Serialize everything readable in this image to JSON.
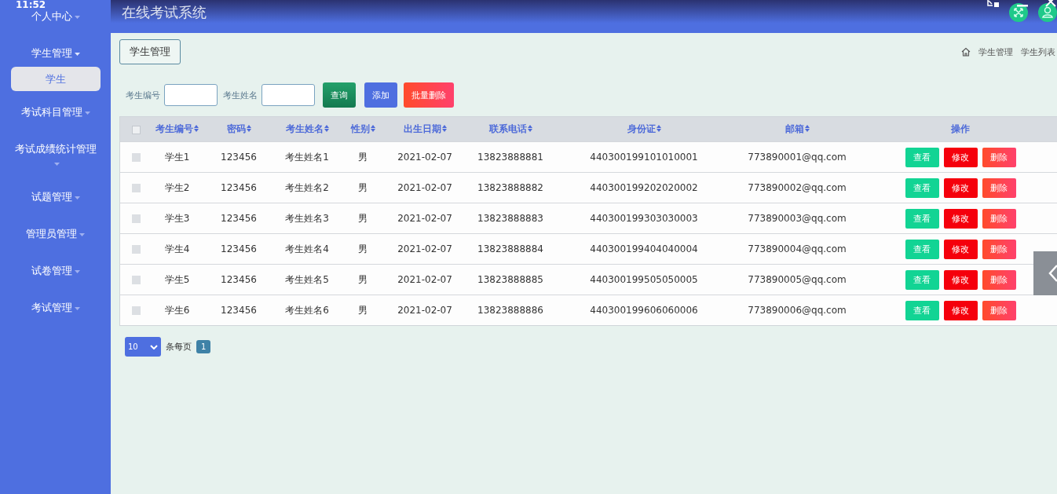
{
  "status_time": "11:52",
  "header": {
    "title": "在线考试系统"
  },
  "sidebar": {
    "items": [
      {
        "label": "个人中心",
        "expanded": false
      },
      {
        "label": "学生管理",
        "expanded": true,
        "children": [
          {
            "label": "学生",
            "selected": true
          }
        ]
      },
      {
        "label": "考试科目管理",
        "expanded": false
      },
      {
        "label": "考试成绩统计管理",
        "expanded": false
      },
      {
        "label": "试题管理",
        "expanded": false
      },
      {
        "label": "管理员管理",
        "expanded": false
      },
      {
        "label": "试卷管理",
        "expanded": false
      },
      {
        "label": "考试管理",
        "expanded": false
      }
    ]
  },
  "page_tab": "学生管理",
  "breadcrumb": [
    "学生管理",
    "学生列表"
  ],
  "search": {
    "fields": [
      {
        "label": "考生编号"
      },
      {
        "label": "考生姓名"
      }
    ],
    "buttons": [
      {
        "label": "查询",
        "kind": "query"
      },
      {
        "label": "添加",
        "kind": "add"
      },
      {
        "label": "批量删除",
        "kind": "delete"
      }
    ]
  },
  "table": {
    "select_all_checked": false,
    "columns": [
      {
        "label": "考生编号",
        "sortable": true
      },
      {
        "label": "密码",
        "sortable": true
      },
      {
        "label": "考生姓名",
        "sortable": true
      },
      {
        "label": "性别",
        "sortable": true
      },
      {
        "label": "出生日期",
        "sortable": true
      },
      {
        "label": "联系电话",
        "sortable": true
      },
      {
        "label": "身份证",
        "sortable": true
      },
      {
        "label": "邮箱",
        "sortable": true
      },
      {
        "label": "操作",
        "sortable": false
      }
    ],
    "rows": [
      {
        "checked": false,
        "cells": [
          "学生1",
          "123456",
          "考生姓名1",
          "男",
          "2021-02-07",
          "13823888881",
          "440300199101010001",
          "773890001@qq.com"
        ],
        "actions": [
          {
            "label": "查看",
            "kind": "view"
          },
          {
            "label": "修改",
            "kind": "edit"
          },
          {
            "label": "删除",
            "kind": "delete"
          }
        ]
      },
      {
        "checked": false,
        "cells": [
          "学生2",
          "123456",
          "考生姓名2",
          "男",
          "2021-02-07",
          "13823888882",
          "440300199202020002",
          "773890002@qq.com"
        ],
        "actions": [
          {
            "label": "查看",
            "kind": "view"
          },
          {
            "label": "修改",
            "kind": "edit"
          },
          {
            "label": "删除",
            "kind": "delete"
          }
        ]
      },
      {
        "checked": false,
        "cells": [
          "学生3",
          "123456",
          "考生姓名3",
          "男",
          "2021-02-07",
          "13823888883",
          "440300199303030003",
          "773890003@qq.com"
        ],
        "actions": [
          {
            "label": "查看",
            "kind": "view"
          },
          {
            "label": "修改",
            "kind": "edit"
          },
          {
            "label": "删除",
            "kind": "delete"
          }
        ]
      },
      {
        "checked": false,
        "cells": [
          "学生4",
          "123456",
          "考生姓名4",
          "男",
          "2021-02-07",
          "13823888884",
          "440300199404040004",
          "773890004@qq.com"
        ],
        "actions": [
          {
            "label": "查看",
            "kind": "view"
          },
          {
            "label": "修改",
            "kind": "edit"
          },
          {
            "label": "删除",
            "kind": "delete"
          }
        ]
      },
      {
        "checked": false,
        "cells": [
          "学生5",
          "123456",
          "考生姓名5",
          "男",
          "2021-02-07",
          "13823888885",
          "440300199505050005",
          "773890005@qq.com"
        ],
        "actions": [
          {
            "label": "查看",
            "kind": "view"
          },
          {
            "label": "修改",
            "kind": "edit"
          },
          {
            "label": "删除",
            "kind": "delete"
          }
        ]
      },
      {
        "checked": false,
        "cells": [
          "学生6",
          "123456",
          "考生姓名6",
          "男",
          "2021-02-07",
          "13823888886",
          "440300199606060006",
          "773890006@qq.com"
        ],
        "actions": [
          {
            "label": "查看",
            "kind": "view"
          },
          {
            "label": "修改",
            "kind": "edit"
          },
          {
            "label": "删除",
            "kind": "delete"
          }
        ]
      }
    ]
  },
  "pagination": {
    "page_size": "10",
    "per_page_label": "条每页",
    "pages": [
      {
        "label": "1",
        "selected": true
      }
    ]
  }
}
